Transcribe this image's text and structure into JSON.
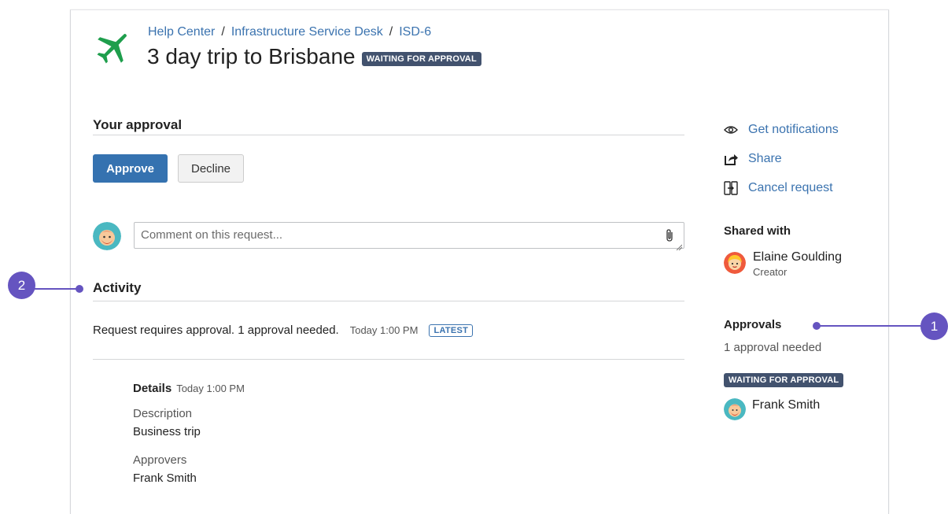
{
  "breadcrumb": {
    "items": [
      "Help Center",
      "Infrastructure Service Desk",
      "ISD-6"
    ],
    "separator": "/"
  },
  "request": {
    "title": "3 day trip to Brisbane",
    "status": "WAITING FOR APPROVAL",
    "icon": "airplane-icon"
  },
  "approval": {
    "heading": "Your approval",
    "approve_label": "Approve",
    "decline_label": "Decline"
  },
  "comment": {
    "placeholder": "Comment on this request..."
  },
  "activity": {
    "heading": "Activity",
    "latest_text": "Request requires approval. 1 approval needed.",
    "latest_time": "Today 1:00 PM",
    "latest_badge": "LATEST",
    "details_label": "Details",
    "details_time": "Today 1:00 PM",
    "fields": [
      {
        "label": "Description",
        "value": "Business trip"
      },
      {
        "label": "Approvers",
        "value": "Frank Smith"
      }
    ]
  },
  "sidebar": {
    "actions": [
      {
        "label": "Get notifications",
        "icon": "eye-icon"
      },
      {
        "label": "Share",
        "icon": "share-icon"
      },
      {
        "label": "Cancel request",
        "icon": "cancel-request-icon"
      }
    ],
    "shared_with_heading": "Shared with",
    "shared_with": [
      {
        "name": "Elaine Goulding",
        "role": "Creator"
      }
    ],
    "approvals_heading": "Approvals",
    "approvals_needed": "1 approval needed",
    "approvals_status": "WAITING FOR APPROVAL",
    "approvers": [
      {
        "name": "Frank Smith"
      }
    ]
  },
  "callouts": [
    "1",
    "2"
  ],
  "colors": {
    "link": "#3b73af",
    "primary_button": "#3572b0",
    "status_lozenge": "#42526e",
    "callout": "#6554c0",
    "plane": "#1e9e4c"
  }
}
